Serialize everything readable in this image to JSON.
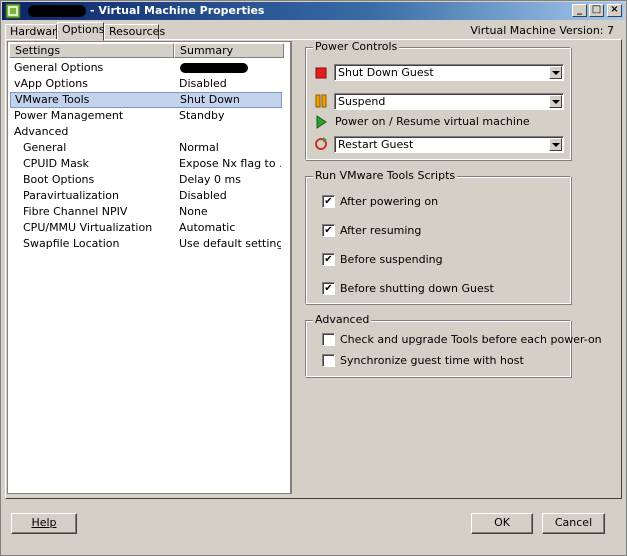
{
  "window": {
    "title": "- Virtual Machine Properties",
    "minimize_glyph": "_",
    "maximize_glyph": "□",
    "close_glyph": "×"
  },
  "tabs": [
    {
      "label": "Hardware",
      "active": false
    },
    {
      "label": "Options",
      "active": true
    },
    {
      "label": "Resources",
      "active": false
    }
  ],
  "version_label": "Virtual Machine Version: 7",
  "settings_list": {
    "columns": [
      "Settings",
      "Summary"
    ],
    "rows": [
      {
        "name": "General Options",
        "summary": "",
        "indent": false,
        "selected": false,
        "redacted": true
      },
      {
        "name": "vApp Options",
        "summary": "Disabled",
        "indent": false,
        "selected": false
      },
      {
        "name": "VMware Tools",
        "summary": "Shut Down",
        "indent": false,
        "selected": true
      },
      {
        "name": "Power Management",
        "summary": "Standby",
        "indent": false,
        "selected": false
      },
      {
        "name": "Advanced",
        "summary": "",
        "indent": false,
        "selected": false
      },
      {
        "name": "General",
        "summary": "Normal",
        "indent": true,
        "selected": false
      },
      {
        "name": "CPUID Mask",
        "summary": "Expose Nx flag to ...",
        "indent": true,
        "selected": false
      },
      {
        "name": "Boot Options",
        "summary": "Delay 0 ms",
        "indent": true,
        "selected": false
      },
      {
        "name": "Paravirtualization",
        "summary": "Disabled",
        "indent": true,
        "selected": false
      },
      {
        "name": "Fibre Channel NPIV",
        "summary": "None",
        "indent": true,
        "selected": false
      },
      {
        "name": "CPU/MMU Virtualization",
        "summary": "Automatic",
        "indent": true,
        "selected": false
      },
      {
        "name": "Swapfile Location",
        "summary": "Use default settings",
        "indent": true,
        "selected": false
      }
    ]
  },
  "power_controls": {
    "label": "Power Controls",
    "stop_select": "Shut Down Guest",
    "suspend_select": "Suspend",
    "power_on_label": "Power on / Resume virtual machine",
    "reset_select": "Restart Guest",
    "colors": {
      "stop": "#e0201c",
      "suspend": "#f0a000",
      "play": "#2ca02c",
      "reset": "#d03020"
    }
  },
  "scripts_group": {
    "label": "Run VMware Tools Scripts",
    "items": [
      {
        "label": "After powering on",
        "checked": true
      },
      {
        "label": "After resuming",
        "checked": true
      },
      {
        "label": "Before suspending",
        "checked": true
      },
      {
        "label": "Before shutting down Guest",
        "checked": true
      }
    ]
  },
  "advanced_group": {
    "label": "Advanced",
    "items": [
      {
        "label": "Check and upgrade Tools before each power-on",
        "checked": false
      },
      {
        "label": "Synchronize guest time with host",
        "checked": false
      }
    ]
  },
  "buttons": {
    "help": "Help",
    "ok": "OK",
    "cancel": "Cancel"
  },
  "check_glyph": "✔",
  "colors": {
    "selection_bg": "#c3d3ec",
    "selection_border": "#7e99c8",
    "title_start": "#0a246a"
  }
}
